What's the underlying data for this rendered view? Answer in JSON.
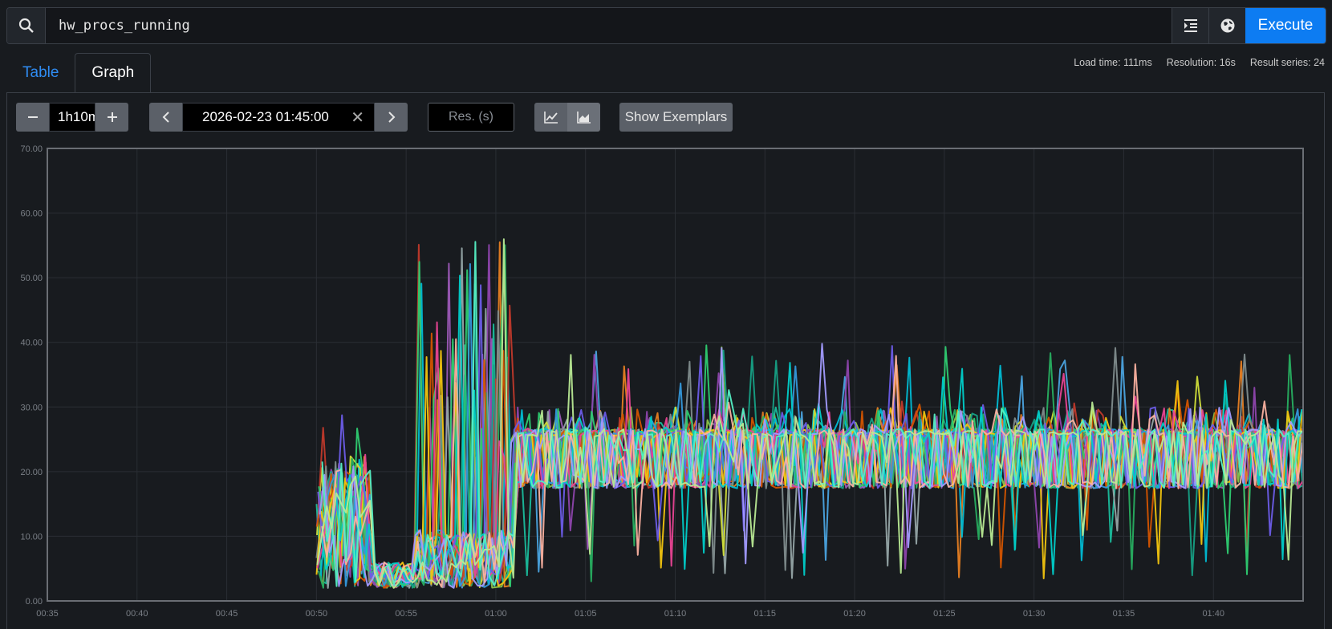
{
  "query": {
    "value": "hw_procs_running",
    "execute_label": "Execute"
  },
  "tabs": {
    "table": "Table",
    "graph": "Graph"
  },
  "stats": {
    "load_time": "Load time: 111ms",
    "resolution": "Resolution: 16s",
    "result_series": "Result series: 24"
  },
  "controls": {
    "range": "1h10m",
    "end_time": "2026-02-23 01:45:00",
    "res_placeholder": "Res. (s)",
    "exemplars_label": "Show Exemplars"
  },
  "chart_data": {
    "type": "line",
    "title": "",
    "xlabel": "",
    "ylabel": "",
    "ylim": [
      0,
      70
    ],
    "xlim": [
      "00:35",
      "01:45"
    ],
    "y_ticks": [
      "0.00",
      "10.00",
      "20.00",
      "30.00",
      "40.00",
      "50.00",
      "60.00",
      "70.00"
    ],
    "x_ticks": [
      "00:35",
      "00:40",
      "00:45",
      "00:50",
      "00:55",
      "01:00",
      "01:05",
      "01:10",
      "01:15",
      "01:20",
      "01:25",
      "01:30",
      "01:35",
      "01:40"
    ],
    "series_count": 24,
    "series_colors": [
      "#4aa3df",
      "#8bc34a",
      "#9b59b6",
      "#1abc9c",
      "#e67e22",
      "#95a5a6",
      "#00bcd4",
      "#cddc39",
      "#8e44ad",
      "#27ae60",
      "#c0392b",
      "#16a085",
      "#d35400",
      "#7f8c8d",
      "#2ecc71",
      "#3498db",
      "#f1c40f",
      "#e84393",
      "#6c5ce7",
      "#00cec9",
      "#a29bfe",
      "#fab1a0",
      "#55efc4",
      "#b8e994"
    ],
    "series_summary": {
      "start": "00:50",
      "phase_1": {
        "from": "00:50",
        "to": "00:53",
        "range": [
          1,
          29
        ]
      },
      "phase_2": {
        "from": "00:53",
        "to": "01:01",
        "range": [
          2,
          59
        ]
      },
      "phase_3": {
        "from": "01:01",
        "to": "01:45",
        "range": [
          3,
          41
        ],
        "typical_levels": [
          18,
          26
        ]
      }
    }
  }
}
